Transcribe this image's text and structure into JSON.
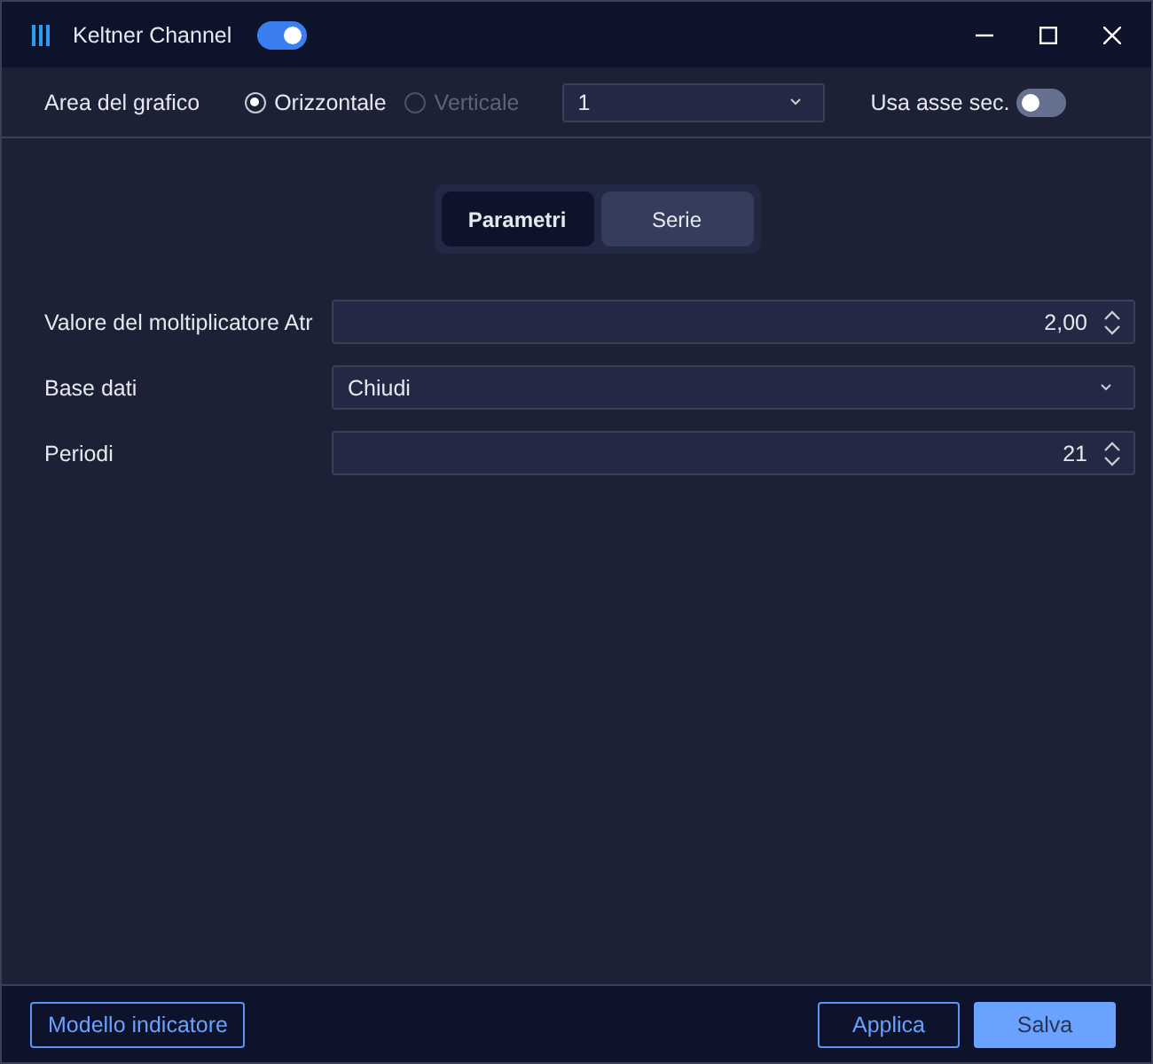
{
  "window": {
    "title": "Keltner Channel",
    "enabled": {
      "on": true
    }
  },
  "chart_area": {
    "label": "Area del grafico",
    "options": [
      {
        "label": "Orizzontale",
        "selected": true,
        "disabled": false
      },
      {
        "label": "Verticale",
        "selected": false,
        "disabled": true
      }
    ],
    "pane": "1",
    "secondary_axis": {
      "label": "Usa asse sec.",
      "on": false
    }
  },
  "tabs": [
    {
      "label": "Parametri",
      "selected": true
    },
    {
      "label": "Serie",
      "selected": false
    }
  ],
  "fields": [
    {
      "label": "Valore del moltiplicatore Atr",
      "kind": "number",
      "value": "2,00"
    },
    {
      "label": "Base dati",
      "kind": "select",
      "value": "Chiudi"
    },
    {
      "label": "Periodi",
      "kind": "number",
      "value": "21"
    }
  ],
  "footer": {
    "template_button": "Modello indicatore",
    "buttons": [
      {
        "label": "Applica",
        "kind": "secondary"
      },
      {
        "label": "Salva",
        "kind": "primary"
      }
    ]
  }
}
